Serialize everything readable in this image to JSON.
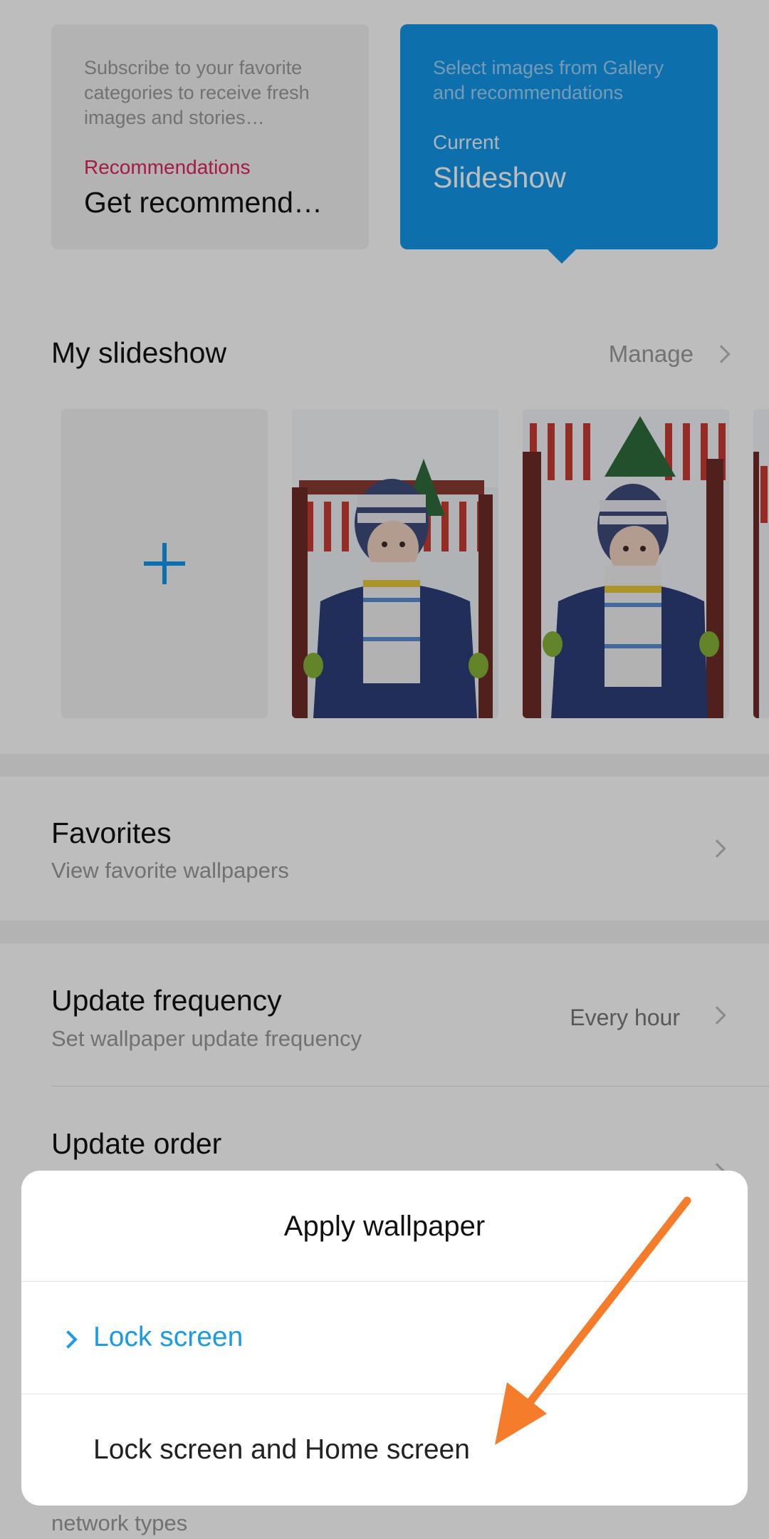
{
  "cards": {
    "recommendations": {
      "description": "Subscribe to your favorite categories to receive fresh images and stories…",
      "kicker": "Recommendations",
      "title": "Get recommend…"
    },
    "slideshow": {
      "description": "Select images from Gallery and recommendations",
      "kicker": "Current",
      "title": "Slideshow"
    }
  },
  "my_slideshow": {
    "title": "My slideshow",
    "manage_label": "Manage"
  },
  "favorites": {
    "title": "Favorites",
    "subtitle": "View favorite wallpapers"
  },
  "update_frequency": {
    "title": "Update frequency",
    "subtitle": "Set wallpaper update frequency",
    "value": "Every hour"
  },
  "update_order": {
    "title": "Update order"
  },
  "network": {
    "subtitle_tail": "network types"
  },
  "dialog": {
    "title": "Apply wallpaper",
    "options": [
      {
        "label": "Lock screen",
        "selected": true
      },
      {
        "label": "Lock screen and Home screen",
        "selected": false
      }
    ]
  },
  "colors": {
    "accent": "#1296e8",
    "recommendation_pink": "#e0245e",
    "annotation_arrow": "#f47c2a"
  }
}
